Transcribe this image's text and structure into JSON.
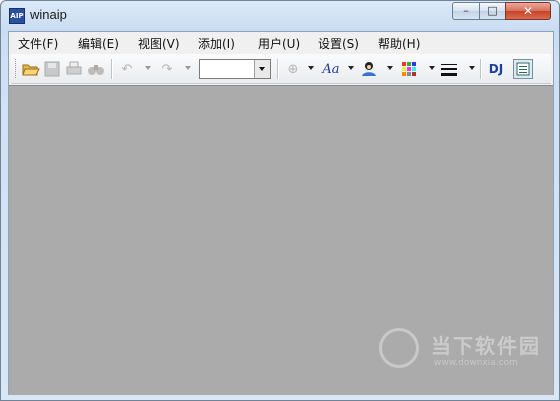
{
  "window": {
    "title": "winaip",
    "app_icon_text": "AIP",
    "minimize": "–",
    "maximize": "□",
    "close": "✕"
  },
  "menu": [
    "文件(F)",
    "编辑(E)",
    "视图(V)",
    "添加(I)",
    "用户(U)",
    "设置(S)",
    "帮助(H)"
  ],
  "toolbar": {
    "combo_value": "",
    "dj_label": "DJ",
    "font_label": "Aa"
  },
  "watermark": {
    "main": "当下软件园",
    "sub": "www.downxia.com"
  },
  "colors": {
    "client_bg": "#ababab",
    "menu_bg": "#f0f0f0"
  }
}
